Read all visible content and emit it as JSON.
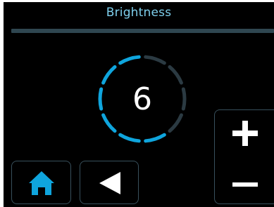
{
  "header": {
    "title": "Brightness"
  },
  "brightness": {
    "value": "6",
    "level": 6,
    "max": 10
  },
  "colors": {
    "accent": "#0fa5dd",
    "inactive": "#2b3a42",
    "title": "#7ecfec",
    "border": "#38505c",
    "background": "#000000"
  },
  "buttons": {
    "home": {
      "icon": "home-icon"
    },
    "back": {
      "icon": "back-triangle-icon"
    },
    "increase": {
      "icon": "plus-icon"
    },
    "decrease": {
      "icon": "minus-icon"
    }
  }
}
